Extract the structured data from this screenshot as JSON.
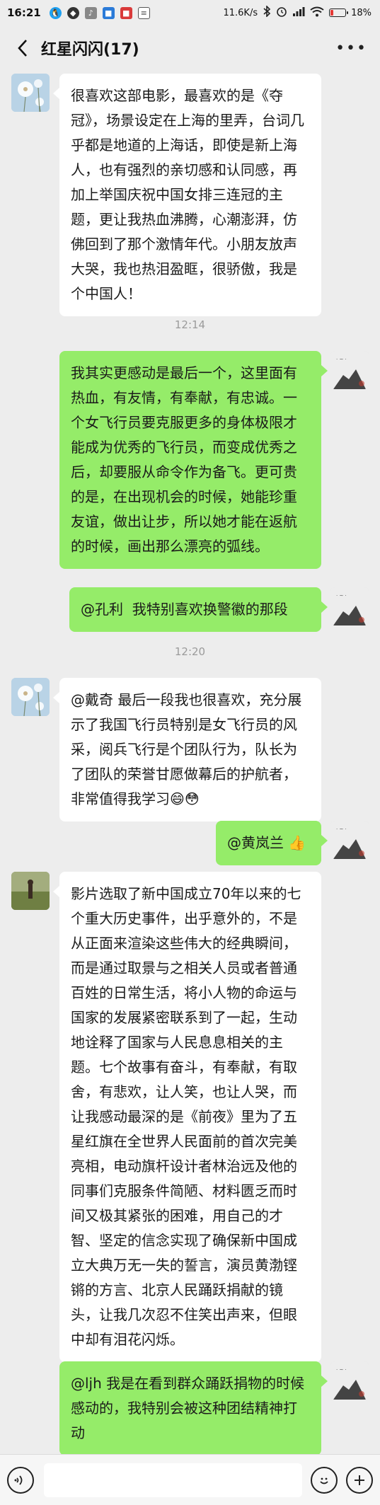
{
  "status_bar": {
    "time": "16:21",
    "network_speed": "11.6K/s",
    "battery_percent": "18%",
    "battery_level": 0.18,
    "icons": [
      "qq-icon",
      "shield-app-icon",
      "music-app-icon",
      "blue-app-icon",
      "red-app-icon",
      "document-icon",
      "bluetooth-icon",
      "alarm-icon",
      "signal-icon",
      "wifi-icon",
      "battery-icon"
    ]
  },
  "header": {
    "title": "红星闪闪(17)",
    "back_icon": "chevron-left-icon",
    "more_icon": "more-dots-icon",
    "more_glyph": "•••"
  },
  "messages": [
    {
      "side": "in",
      "avatar": "dandelion-avatar",
      "text": "很喜欢这部电影，最喜欢的是《夺冠》，场景设定在上海的里弄，台词几乎都是地道的上海话，即使是新上海人，也有强烈的亲切感和认同感，再加上举国庆祝中国女排三连冠的主题，更让我热血沸腾，心潮澎湃，仿佛回到了那个激情年代。小朋友放声大哭，我也热泪盈眶，很骄傲，我是个中国人！"
    },
    {
      "side": "out",
      "avatar": "self-avatar",
      "text": "我其实更感动是最后一个，这里面有热血，有友情，有奉献，有忠诚。一个女飞行员要克服更多的身体极限才能成为优秀的飞行员，而变成优秀之后，却要服从命令作为备飞。更可贵的是，在出现机会的时候，她能珍重友谊，做出让步，所以她才能在返航的时候，画出那么漂亮的弧线。"
    },
    {
      "side": "out",
      "avatar": "self-avatar",
      "text": "@孔利  我特别喜欢换警徽的那段"
    },
    {
      "side": "in",
      "avatar": "dandelion-avatar",
      "text": "@戴奇 最后一段我也很喜欢，充分展示了我国飞行员特别是女飞行员的风采，阅兵飞行是个团队行为，队长为了团队的荣誉甘愿做幕后的护航者，非常值得我学习😄😳"
    },
    {
      "side": "out",
      "avatar": "self-avatar",
      "text": "@黄岚兰 👍"
    },
    {
      "side": "in",
      "avatar": "field-avatar",
      "text": "影片选取了新中国成立70年以来的七个重大历史事件，出乎意外的，不是从正面来渲染这些伟大的经典瞬间，而是通过取景与之相关人员或者普通百姓的日常生活，将小人物的命运与国家的发展紧密联系到了一起，生动地诠释了国家与人民息息相关的主题。七个故事有奋斗，有奉献，有取舍，有悲欢，让人笑，也让人哭，而让我感动最深的是《前夜》里为了五星红旗在全世界人民面前的首次完美亮相，电动旗杆设计者林治远及他的同事们克服条件简陋、材料匮乏而时间又极其紧张的困难，用自己的才智、坚定的信念实现了确保新中国成立大典万无一失的誓言，演员黄渤铿锵的方言、北京人民踊跃捐献的镜头，让我几次忍不住笑出声来，但眼中却有泪花闪烁。"
    },
    {
      "side": "out",
      "avatar": "self-avatar",
      "text": "@ljh 我是在看到群众踊跃捐物的时候感动的，我特别会被这种团结精神打动"
    }
  ],
  "time_dividers": [
    "12:14",
    "12:20"
  ],
  "input_bar": {
    "voice_icon": "voice-icon",
    "emoji_icon": "emoji-icon",
    "plus_icon": "plus-icon",
    "text_value": ""
  },
  "colors": {
    "background": "#ededed",
    "outgoing_bubble": "#95ec69",
    "incoming_bubble": "#ffffff",
    "timestamp": "#9b9b9b"
  }
}
